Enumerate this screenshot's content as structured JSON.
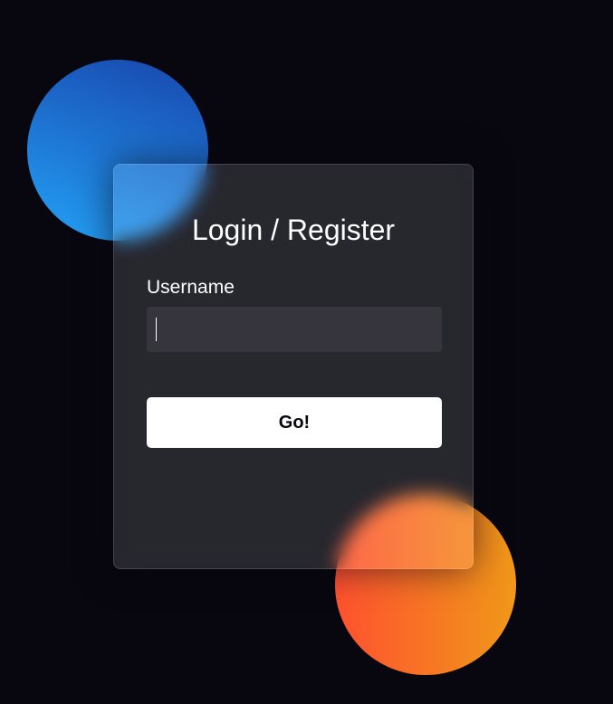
{
  "form": {
    "title": "Login / Register",
    "username_label": "Username",
    "username_value": "",
    "submit_label": "Go!"
  },
  "colors": {
    "background": "#080710",
    "blue_blob_start": "#1845ad",
    "blue_blob_end": "#23a2f6",
    "orange_blob_start": "#ff512f",
    "orange_blob_end": "#f09819",
    "button_background": "#ffffff",
    "button_text": "#080710"
  }
}
